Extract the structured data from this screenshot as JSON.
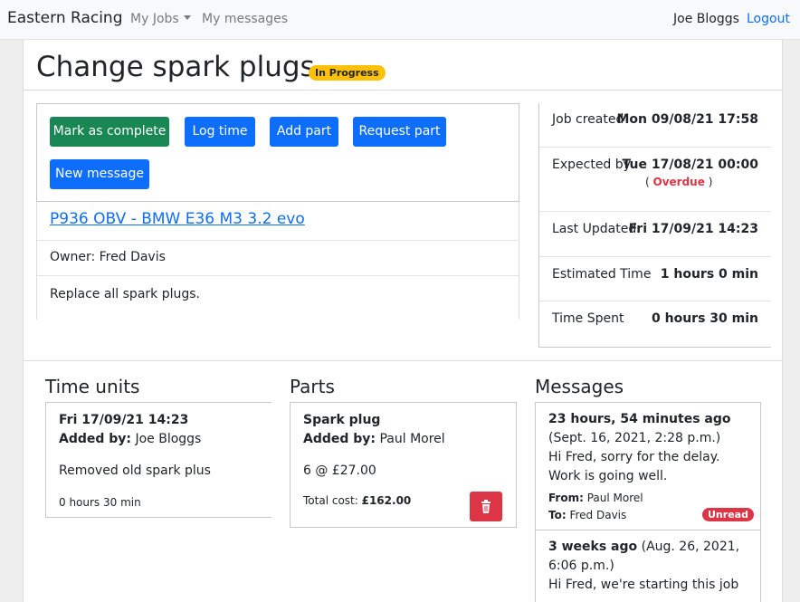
{
  "navbar": {
    "brand": "Eastern Racing",
    "my_jobs": "My Jobs",
    "my_messages": "My messages",
    "user": "Joe Bloggs",
    "logout": "Logout"
  },
  "job": {
    "title": "Change spark plugs",
    "status": "In Progress",
    "car_link": "P936 OBV - BMW E36 M3 3.2 evo",
    "owner": "Owner: Fred Davis",
    "description": "Replace all spark plugs."
  },
  "actions": {
    "mark_complete": "Mark as complete",
    "log_time": "Log time",
    "add_part": "Add part",
    "request_part": "Request part",
    "new_message": "New message"
  },
  "info": {
    "created_label": "Job created",
    "created_value": "Mon 09/08/21 17:58",
    "expected_label": "Expected by",
    "expected_value": "Tue 17/08/21 00:00",
    "overdue_open": "(",
    "overdue_text": "Overdue",
    "overdue_close": ")",
    "updated_label": "Last Updated",
    "updated_value": "Fri 17/09/21 14:23",
    "estimated_label": "Estimated Time",
    "estimated_value": "1 hours 0 min",
    "spent_label": "Time Spent",
    "spent_value": "0 hours 30 min"
  },
  "time_units": {
    "heading": "Time units",
    "date": "Fri 17/09/21 14:23",
    "added_by_label": "Added by:",
    "added_by": "Joe Bloggs",
    "note": "Removed old spark plus",
    "duration": "0 hours 30 min"
  },
  "parts": {
    "heading": "Parts",
    "name": "Spark plug",
    "added_by_label": "Added by:",
    "added_by": "Paul Morel",
    "quantity_price": "6 @ £27.00",
    "total_label": "Total cost:",
    "total_value": "£162.00",
    "delete_icon": "trash-icon"
  },
  "messages": {
    "heading": "Messages",
    "items": [
      {
        "ago": "23 hours, 54 minutes ago",
        "date": "(Sept. 16, 2021, 2:28 p.m.)",
        "body": "Hi Fred, sorry for the delay. Work is going well.",
        "from_label": "From:",
        "from": "Paul Morel",
        "to_label": "To:",
        "to": "Fred Davis",
        "badge": "Unread"
      },
      {
        "ago": "3 weeks ago",
        "date": "(Aug. 26, 2021, 6:06 p.m.)",
        "body": "Hi Fred, we're starting this job"
      }
    ]
  },
  "colors": {
    "primary": "#0d6efd",
    "success": "#198754",
    "warning": "#ffc107",
    "danger": "#dc3545"
  }
}
